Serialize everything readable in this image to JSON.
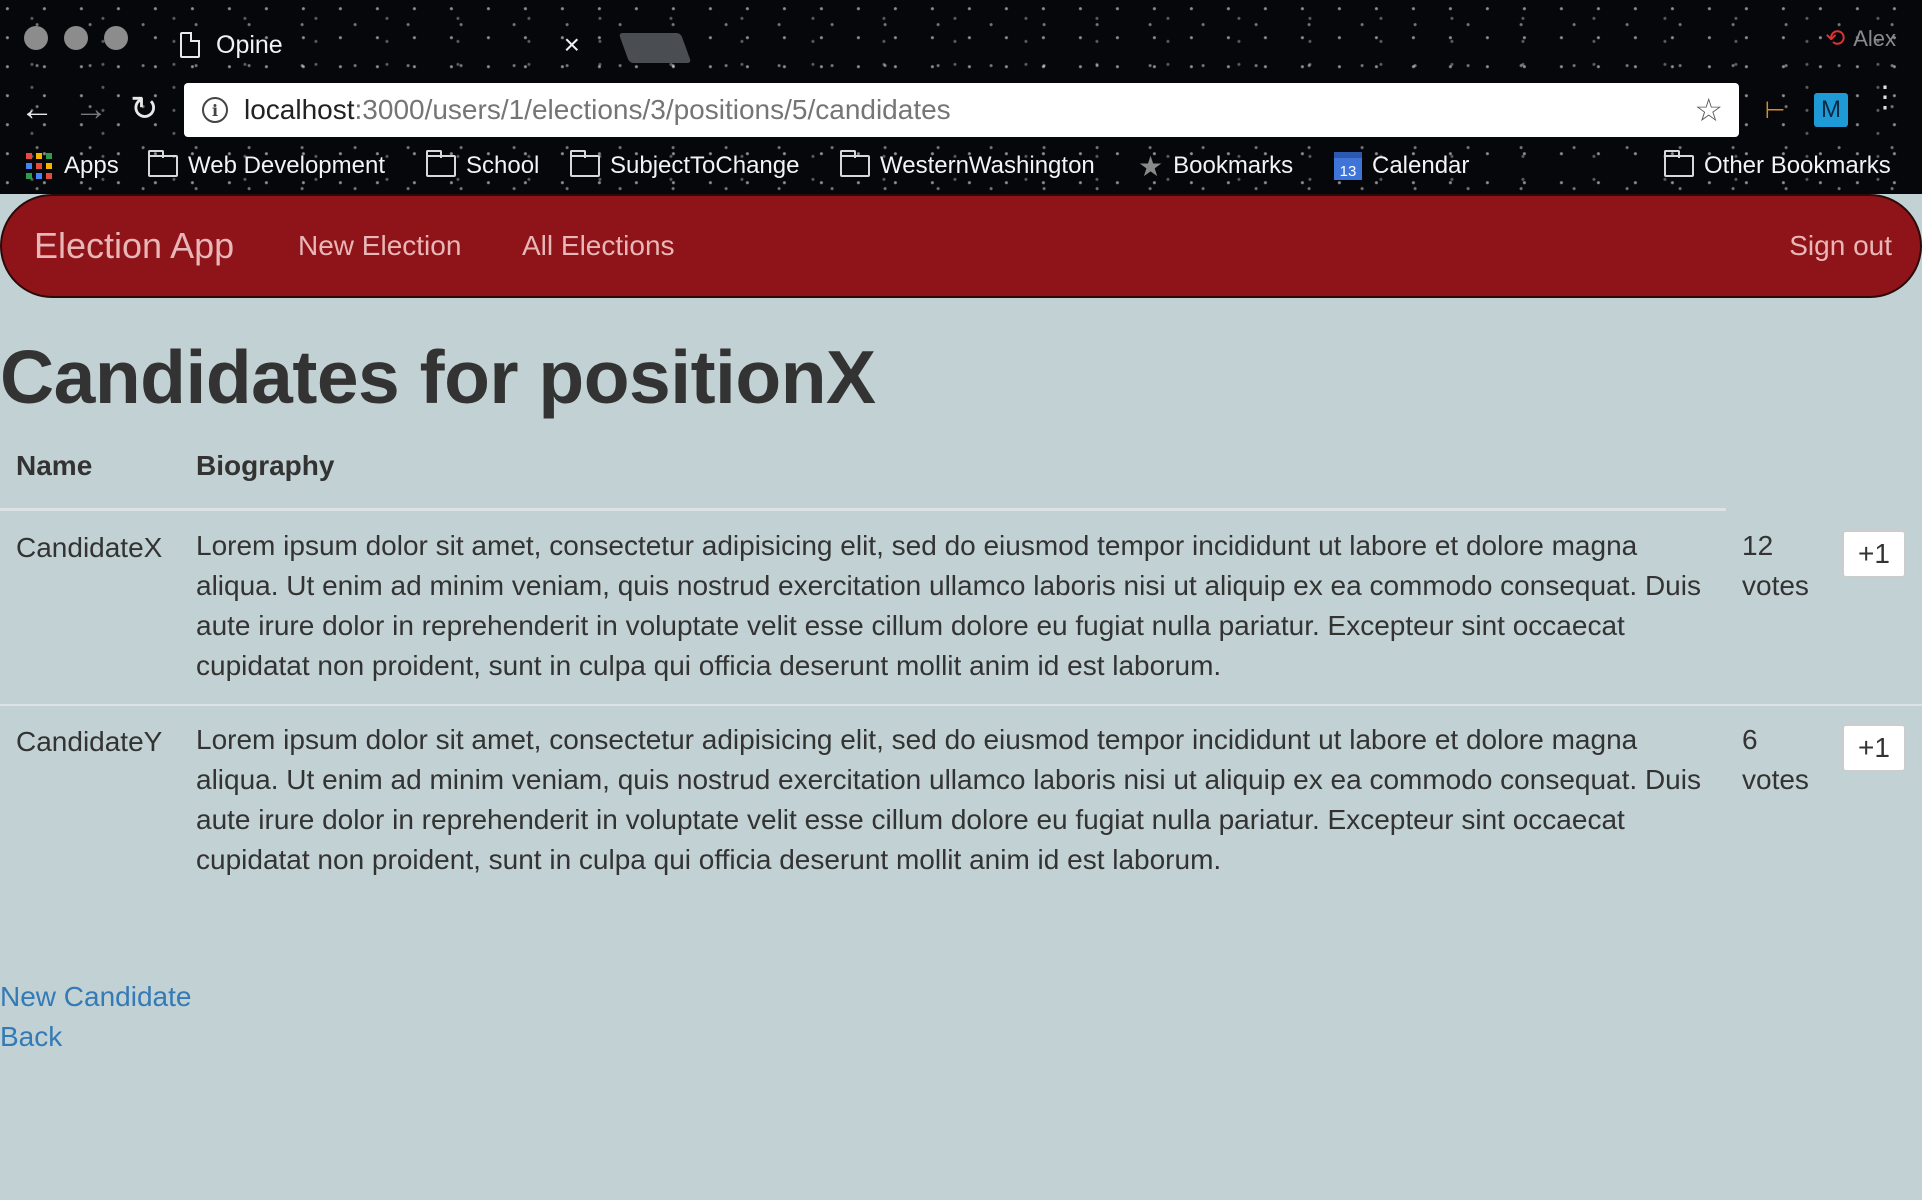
{
  "browser": {
    "tab_title": "Opine",
    "tab_close": "×",
    "url_host": "localhost",
    "url_path": ":3000/users/1/elections/3/positions/5/candidates",
    "profile_name": "Alex",
    "back_glyph": "←",
    "forward_glyph": "→",
    "reload_glyph": "↻",
    "star_glyph": "☆",
    "menu_glyph": "⋮",
    "ext_m_label": "M",
    "bookmarks": {
      "apps": "Apps",
      "web_development": "Web Development",
      "school": "School",
      "subject_to_change": "SubjectToChange",
      "western_washington": "WesternWashington",
      "bookmarks": "Bookmarks",
      "calendar": "Calendar",
      "calendar_day": "13",
      "other_bookmarks": "Other Bookmarks"
    }
  },
  "navbar": {
    "brand": "Election App",
    "new_election": "New Election",
    "all_elections": "All Elections",
    "sign_out": "Sign out",
    "color": "#8f1419"
  },
  "page": {
    "title": "Candidates for positionX",
    "table": {
      "headers": {
        "name": "Name",
        "biography": "Biography"
      },
      "rows": [
        {
          "name": "CandidateX",
          "biography": "Lorem ipsum dolor sit amet, consectetur adipisicing elit, sed do eiusmod tempor incididunt ut labore et dolore magna aliqua. Ut enim ad minim veniam, quis nostrud exercitation ullamco laboris nisi ut aliquip ex ea commodo consequat. Duis aute irure dolor in reprehenderit in voluptate velit esse cillum dolore eu fugiat nulla pariatur. Excepteur sint occaecat cupidatat non proident, sunt in culpa qui officia deserunt mollit anim id est laborum.",
          "votes": "12",
          "votes_label": "votes",
          "button": "+1"
        },
        {
          "name": "CandidateY",
          "biography": "Lorem ipsum dolor sit amet, consectetur adipisicing elit, sed do eiusmod tempor incididunt ut labore et dolore magna aliqua. Ut enim ad minim veniam, quis nostrud exercitation ullamco laboris nisi ut aliquip ex ea commodo consequat. Duis aute irure dolor in reprehenderit in voluptate velit esse cillum dolore eu fugiat nulla pariatur. Excepteur sint occaecat cupidatat non proident, sunt in culpa qui officia deserunt mollit anim id est laborum.",
          "votes": "6",
          "votes_label": "votes",
          "button": "+1"
        }
      ]
    },
    "links": {
      "new_candidate": "New Candidate",
      "back": "Back"
    },
    "link_color": "#337ab7",
    "background": "#c2d1d3"
  }
}
